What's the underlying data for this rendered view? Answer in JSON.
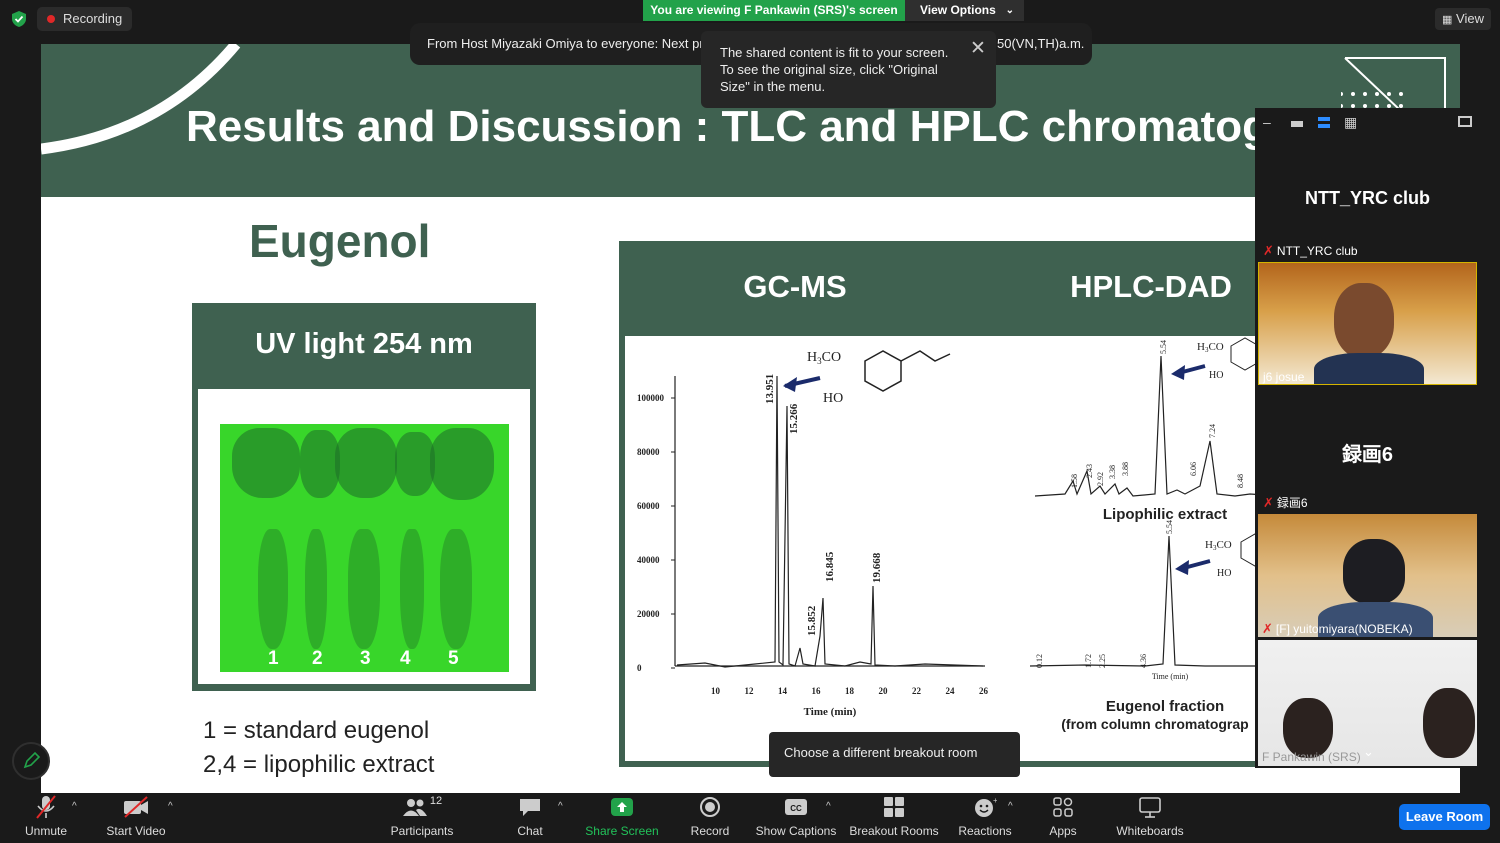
{
  "topbar": {
    "recording_label": "Recording",
    "viewing_label": "You are viewing F Pankawin (SRS)'s screen",
    "view_options_label": "View Options",
    "view_label": "View"
  },
  "notification": {
    "chat_message": "From Host Miyazaki Omiya to everyone: Next pres",
    "chat_message_tail": "50(VN,TH)a.m.",
    "fit_message": "The shared content is fit to your screen. To see the original size, click \"Original Size\" in the menu."
  },
  "slide": {
    "title": "Results and Discussion : TLC and HPLC chromatogra",
    "compound": "Eugenol",
    "uv_title": "UV light 254 nm",
    "lanes": [
      "1",
      "2",
      "3",
      "4",
      "5"
    ],
    "legend": [
      "1 = standard eugenol",
      "2,4 = lipophilic extract"
    ],
    "gcms_title": "GC-MS",
    "hplc_title": "HPLC-DAD",
    "gcms": {
      "y_ticks": [
        "100000",
        "80000",
        "60000",
        "40000",
        "20000",
        "0"
      ],
      "x_ticks": [
        "10",
        "12",
        "14",
        "16",
        "18",
        "20",
        "22",
        "24",
        "26"
      ],
      "x_label": "Time (min)",
      "peaks": [
        "13.951",
        "15.266",
        "15.852",
        "16.845",
        "19.668"
      ]
    },
    "hplc": {
      "top_label": "Lipophilic extract",
      "top_peaks": [
        "1.58",
        "2.43",
        "2.92",
        "3.38",
        "3.88",
        "5.54",
        "6.06",
        "7.24",
        "8.48"
      ],
      "bottom_label": "Eugenol fraction",
      "bottom_sub": "(from column chromatograp",
      "bottom_peaks": [
        "0.12",
        "1.72",
        "2.25",
        "4.36",
        "5.54"
      ],
      "bottom_axis": "Time (min)"
    }
  },
  "gallery": {
    "tiles": [
      {
        "big": "NTT_YRC club",
        "label": "NTT_YRC club"
      },
      {
        "label": "j6 josue"
      },
      {
        "big": "録画6",
        "label": "録画6"
      },
      {
        "label": "[F] yuitomiyara(NOBEKA)"
      },
      {
        "label": "F Pankawin (SRS)"
      }
    ]
  },
  "breakout_tip": "Choose a different breakout room",
  "toolbar": {
    "unmute": "Unmute",
    "start_video": "Start Video",
    "participants": "Participants",
    "participants_count": "12",
    "chat": "Chat",
    "share_screen": "Share Screen",
    "record": "Record",
    "show_captions": "Show Captions",
    "breakout_rooms": "Breakout Rooms",
    "reactions": "Reactions",
    "apps": "Apps",
    "whiteboards": "Whiteboards",
    "leave_room": "Leave Room"
  },
  "colors": {
    "slide_green": "#3f6150",
    "share_green": "#22a24a",
    "leave_blue": "#0e72ed",
    "tlc_green": "#38d62a"
  }
}
